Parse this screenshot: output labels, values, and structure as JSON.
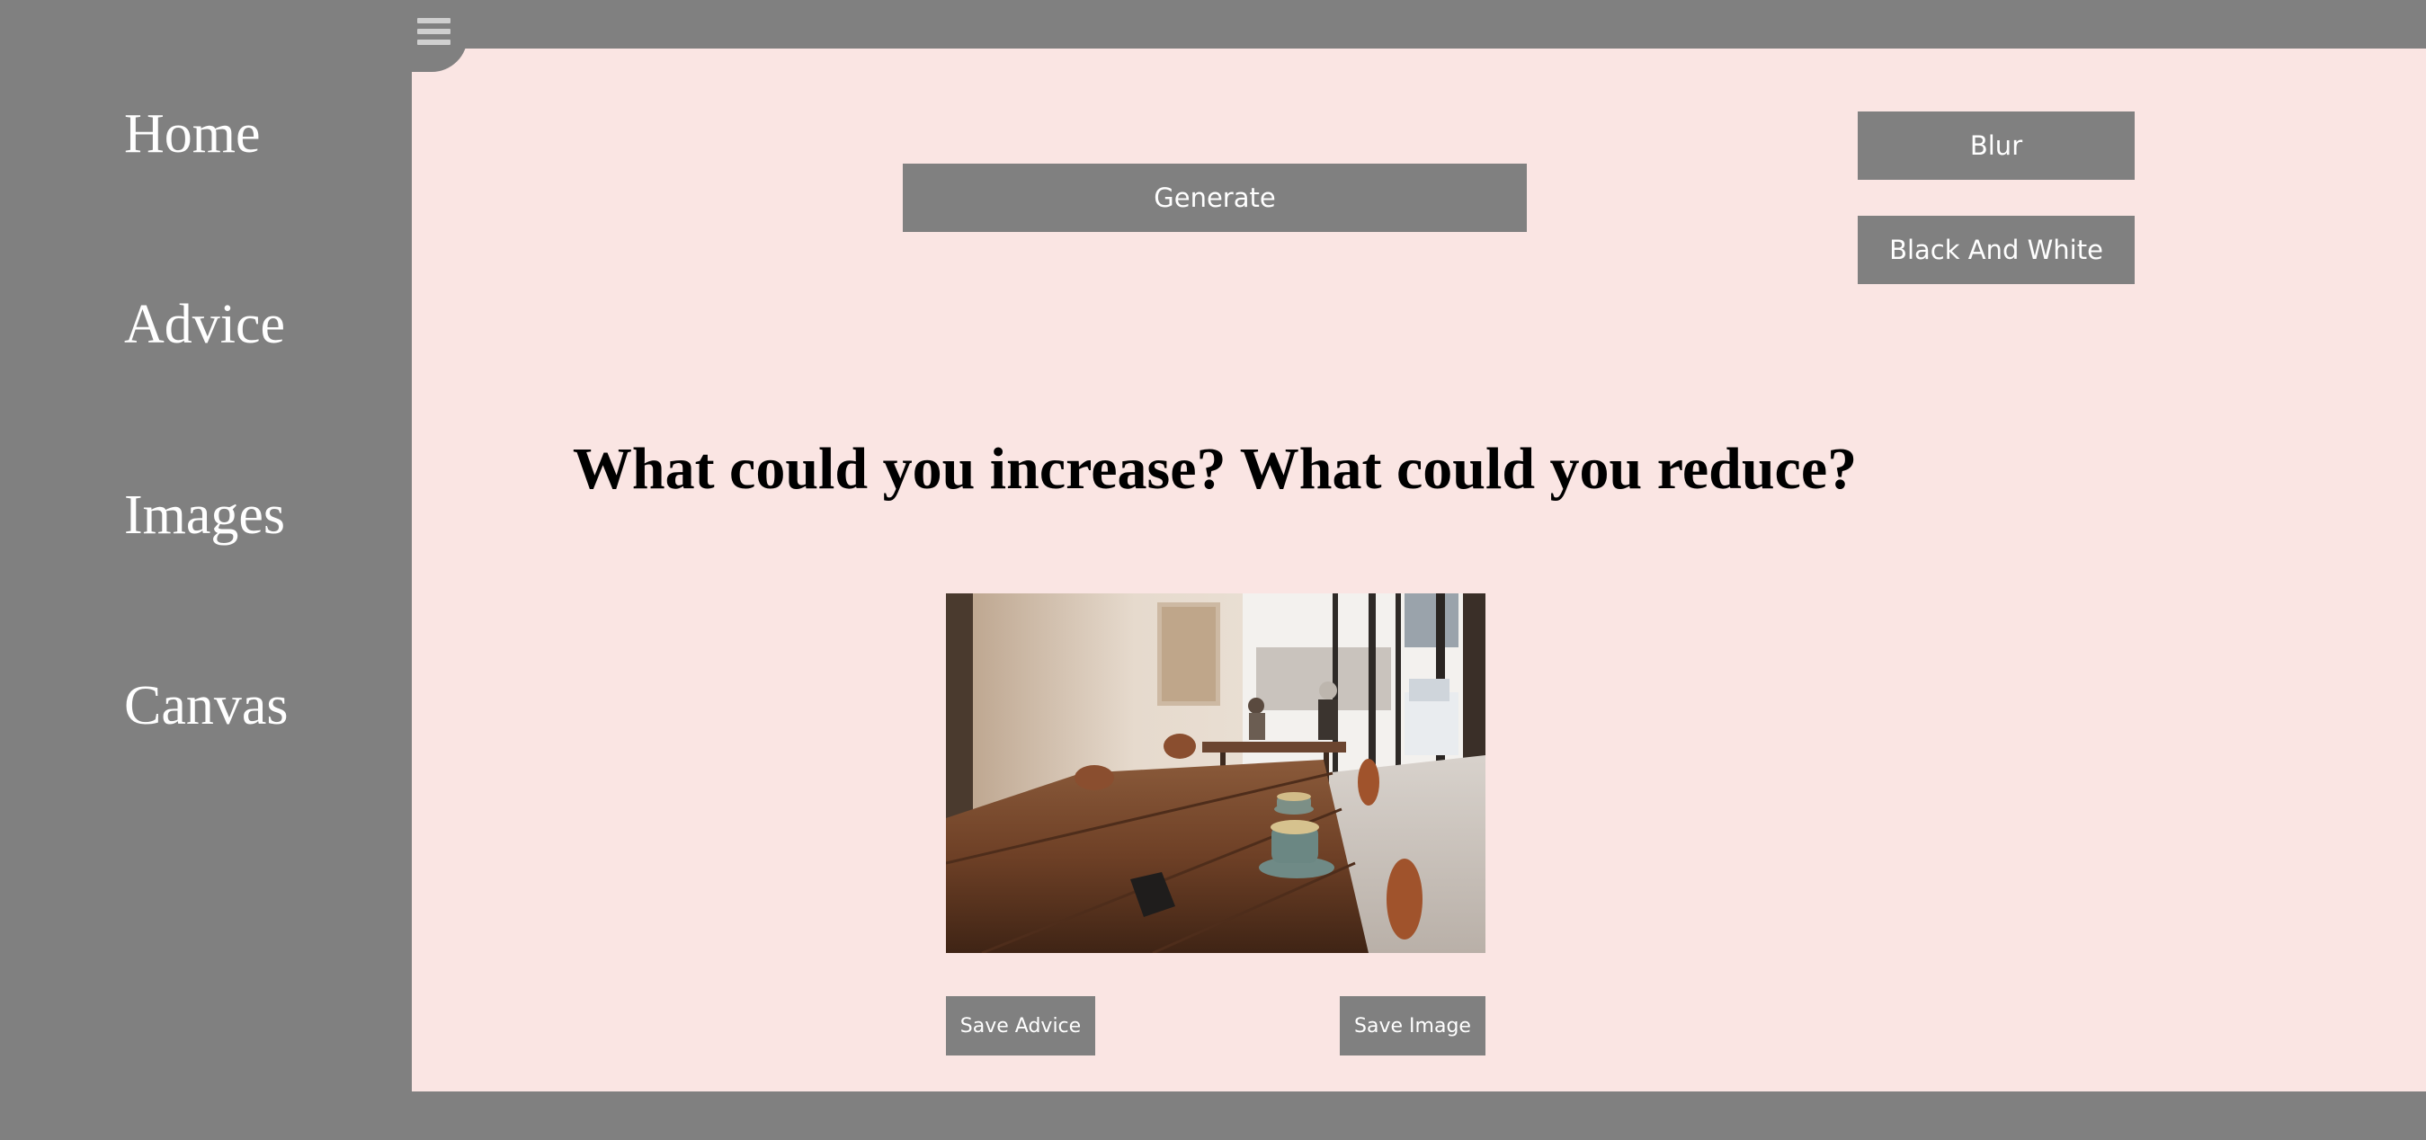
{
  "sidebar": {
    "items": [
      {
        "label": "Home"
      },
      {
        "label": "Advice"
      },
      {
        "label": "Images"
      },
      {
        "label": "Canvas"
      }
    ]
  },
  "menu_toggle": {
    "icon": "hamburger-menu-icon"
  },
  "controls": {
    "generate_label": "Generate",
    "blur_label": "Blur",
    "black_and_white_label": "Black And White"
  },
  "advice": {
    "text": "What could you increase? What could you reduce?"
  },
  "image": {
    "description": "cafe table with coffee cup"
  },
  "actions": {
    "save_advice_label": "Save Advice",
    "save_image_label": "Save Image"
  },
  "colors": {
    "background": "#808080",
    "panel": "#fae5e3",
    "button": "#808080",
    "button_text": "#ffffff"
  }
}
